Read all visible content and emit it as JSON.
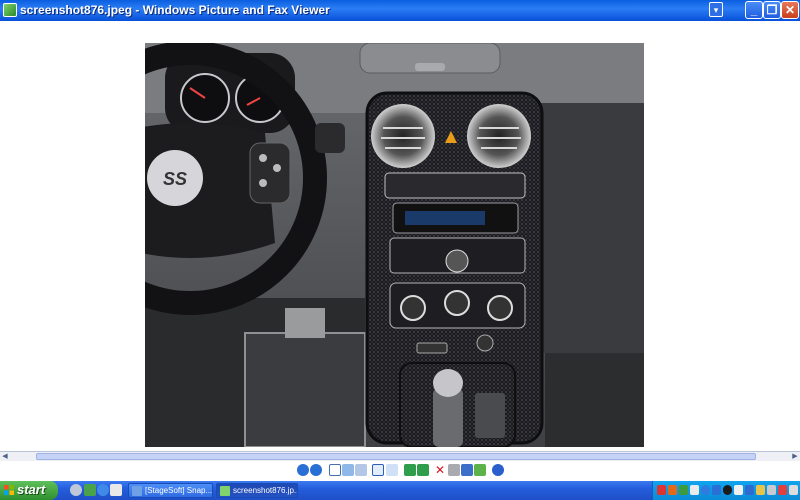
{
  "window": {
    "title": "screenshot876.jpeg - Windows Picture and Fax Viewer",
    "controls": {
      "minimize": "_",
      "maximize": "❐",
      "close": "✕",
      "dropdown": "▾"
    }
  },
  "toolbar": {
    "buttons": [
      "previous-image-icon",
      "next-image-icon",
      "best-fit-icon",
      "actual-size-icon",
      "start-slideshow-icon",
      "zoom-in-icon",
      "zoom-out-icon",
      "rotate-clockwise-icon",
      "rotate-counterclockwise-icon",
      "delete-icon",
      "print-icon",
      "copy-to-icon",
      "close-open-for-editing-icon",
      "help-icon"
    ]
  },
  "taskbar": {
    "start_label": "start",
    "tasks": [
      {
        "label": "[StageSoft] Snap...",
        "active": false
      },
      {
        "label": "screenshot876.jp...",
        "active": true
      }
    ]
  },
  "colors": {
    "title_bar": "#0a5fe0",
    "taskbar": "#245ddc",
    "start_button": "#3c9f3c",
    "tray": "#0f97e2",
    "close_button": "#d8552f"
  }
}
